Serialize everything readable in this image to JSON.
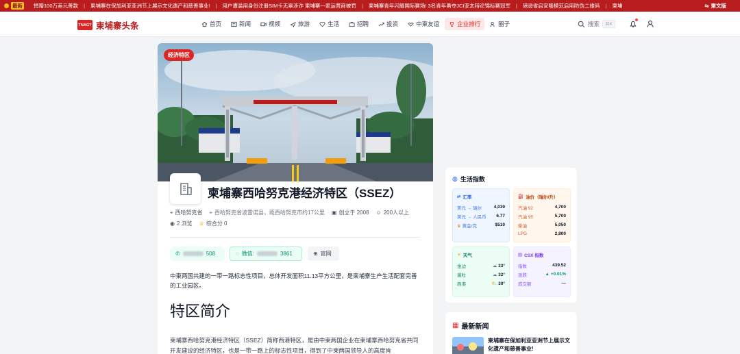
{
  "ticker": {
    "tag": "最新",
    "items": [
      "捐赠100万美元善款",
      "柬埔寨在保加利亚亚洲节上展示文化遗产和慈善事业!",
      "用户遭滥用身份注册SIM卡无辜涉诈 柬埔寨一家运营商被罚",
      "柬埔寨青年闪耀国际赛场! 3名青年勇夺JCI亚太辩论锦标赛冠军",
      "磅逊省启安隆模范启用防伪二维码",
      "柬埔"
    ],
    "lang": "柬文版"
  },
  "header": {
    "logo_badge": "TNAGT",
    "logo_text": "柬埔寨头条",
    "nav": [
      {
        "label": "首页",
        "icon": "home-icon"
      },
      {
        "label": "新闻",
        "icon": "news-icon"
      },
      {
        "label": "视频",
        "icon": "video-icon"
      },
      {
        "label": "旅游",
        "icon": "plane-icon"
      },
      {
        "label": "生活",
        "icon": "heart-icon"
      },
      {
        "label": "招聘",
        "icon": "briefcase-icon"
      },
      {
        "label": "投资",
        "icon": "trend-icon"
      },
      {
        "label": "中柬友谊",
        "icon": "handshake-icon"
      },
      {
        "label": "企业排行",
        "icon": "trophy-icon",
        "active": true
      },
      {
        "label": "圈子",
        "icon": "people-icon"
      }
    ],
    "search_label": "搜索",
    "search_shortcut": "⌘K"
  },
  "zone": {
    "badge": "经济特区",
    "title": "柬埔寨西哈努克港经济特区（SSEZ）",
    "province": "西哈努克省",
    "address": "西哈努克省波雷诺县，距西哈努克市约17公里",
    "founded": "创立于 2008",
    "employees": "200人以上",
    "views": "2 浏览",
    "score": "综合分 0",
    "phone_suffix": "508",
    "wechat_label": "微信:",
    "wechat_suffix": "3861",
    "website": "官网",
    "summary": "中柬两国共建的一带一路标志性项目，总体开发面积11.13平方公里，是柬埔寨生产生活配套完善的工业园区。",
    "intro_heading": "特区简介",
    "intro_text": "柬埔寨西哈努克港经济特区（SSEZ）简称西港特区，是由中柬两国企业在柬埔寨西哈努克省共同开发建设的经济特区，也是一带一路上的标志性项目，得到了中柬两国领导人的高度肯"
  },
  "life": {
    "title": "生活指数",
    "fx": {
      "title": "汇率",
      "rows": [
        {
          "label": "美元 → 瑞尔",
          "value": "4,039"
        },
        {
          "label": "美元 → 人民币",
          "value": "6.77"
        },
        {
          "label": "黄金/克",
          "value": "$510"
        }
      ]
    },
    "oil": {
      "title": "油价（瑞尔/升）",
      "rows": [
        {
          "label": "汽油 92",
          "value": "4,700"
        },
        {
          "label": "汽油 95",
          "value": "5,700"
        },
        {
          "label": "柴油",
          "value": "5,050"
        },
        {
          "label": "LPG",
          "value": "2,800"
        }
      ]
    },
    "weather": {
      "title": "天气",
      "rows": [
        {
          "label": "金边",
          "value": "33°",
          "icon": "cloud-icon"
        },
        {
          "label": "暹粒",
          "value": "32°",
          "icon": "cloud-icon"
        },
        {
          "label": "西港",
          "value": "30°",
          "icon": "sun-cloud-icon"
        }
      ]
    },
    "csx": {
      "title": "CSX 指数",
      "rows": [
        {
          "label": "指数",
          "value": "439.52"
        },
        {
          "label": "涨跌",
          "value": "+0.01%"
        },
        {
          "label": "成交额",
          "value": "—"
        }
      ]
    }
  },
  "news": {
    "title": "最新新闻",
    "items": [
      {
        "headline": "柬埔寨在保加利亚亚洲节上展示文化遗产和慈善事业!"
      }
    ]
  },
  "colors": {
    "brand": "#dc2626",
    "ticker_bg": "#b91c1c",
    "contact_green": "#059669"
  }
}
